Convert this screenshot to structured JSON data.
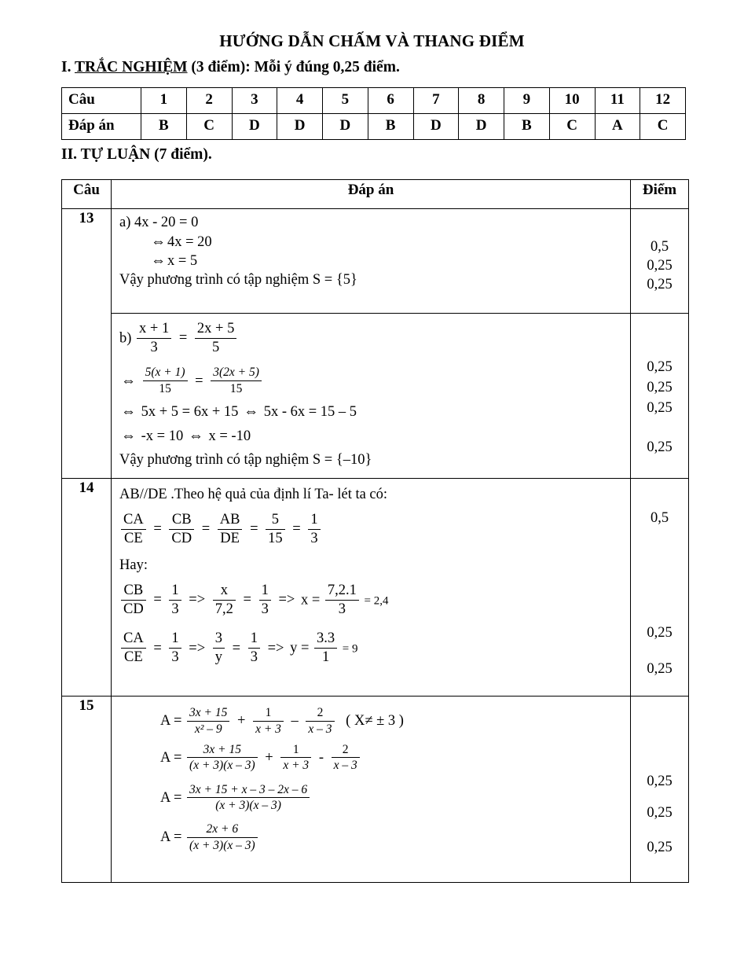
{
  "document": {
    "title": "HƯỚNG DẪN CHẤM VÀ THANG ĐIỂM"
  },
  "section_mcq": {
    "heading_prefix": "I. ",
    "heading_underlined": "TRẮC NGHIỆM",
    "heading_rest": " (3 điểm): Mỗi ý đúng 0,25 điểm.",
    "table": {
      "row_label_question": "Câu",
      "row_label_answer": "Đáp án",
      "questions": [
        "1",
        "2",
        "3",
        "4",
        "5",
        "6",
        "7",
        "8",
        "9",
        "10",
        "11",
        "12"
      ],
      "answers": [
        "B",
        "C",
        "D",
        "D",
        "D",
        "B",
        "D",
        "D",
        "B",
        "C",
        "A",
        "C"
      ]
    }
  },
  "section_essay": {
    "heading_prefix": "II. ",
    "heading_underlined": "TỰ LUẬN",
    "heading_rest": " (7 điểm).",
    "headers": {
      "cau": "Câu",
      "dap_an": "Đáp án",
      "diem": "Điểm"
    },
    "q13": {
      "number": "13",
      "part_a": {
        "l1": "a) 4x - 20 = 0",
        "l2_eqv": "⇔",
        "l2": "4x = 20",
        "l3_eqv": "⇔",
        "l3": "x = 5",
        "l4": "Vậy phương trình có tập nghiệm  S = {5}",
        "points": [
          "0,5",
          "0,25",
          "0,25"
        ]
      },
      "part_b": {
        "label": "b)",
        "eq1": {
          "n1": "x + 1",
          "d1": "3",
          "n2": "2x + 5",
          "d2": "5"
        },
        "eq2": {
          "n1": "5(x + 1)",
          "d1": "15",
          "n2": "3(2x + 5)",
          "d2": "15"
        },
        "eq3": "5x + 5 = 6x + 15",
        "eq3b": "5x - 6x = 15 – 5",
        "eq4": "-x  = 10",
        "eq4b": "x = -10",
        "eq5": "Vậy phương trình có tập nghiệm  S = {–10}",
        "points": [
          "0,25",
          "0,25",
          "0,25",
          "0,25"
        ]
      }
    },
    "q14": {
      "number": "14",
      "l1": "AB//DE .Theo hệ quả của định lí Ta- lét ta có:",
      "chain1": [
        {
          "num": "CA",
          "den": "CE"
        },
        {
          "num": "CB",
          "den": "CD"
        },
        {
          "num": "AB",
          "den": "DE"
        },
        {
          "num": "5",
          "den": "15"
        },
        {
          "num": "1",
          "den": "3"
        }
      ],
      "hay": "Hay:",
      "chain2": {
        "f1": {
          "num": "CB",
          "den": "CD"
        },
        "f2": {
          "num": "1",
          "den": "3"
        },
        "arrow": "=>",
        "f3": {
          "num": "x",
          "den": "7,2"
        },
        "f4": {
          "num": "1",
          "den": "3"
        },
        "arrow2": "=>",
        "var": "x =",
        "f5": {
          "num": "7,2.1",
          "den": "3"
        },
        "result": "= 2,4"
      },
      "chain3": {
        "f1": {
          "num": "CA",
          "den": "CE"
        },
        "f2": {
          "num": "1",
          "den": "3"
        },
        "arrow": "=>",
        "f3": {
          "num": "3",
          "den": "y"
        },
        "f4": {
          "num": "1",
          "den": "3"
        },
        "arrow2": "=>",
        "var": "y =",
        "f5": {
          "num": "3.3",
          "den": "1"
        },
        "result": "= 9"
      },
      "points": [
        "0,5",
        "0,25",
        "0,25"
      ]
    },
    "q15": {
      "number": "15",
      "line1": {
        "lead": "A =",
        "f1": {
          "num": "3x + 15",
          "den": "x² – 9"
        },
        "op1": "+",
        "f2": {
          "num": "1",
          "den": "x + 3"
        },
        "op2": "–",
        "f3": {
          "num": "2",
          "den": "x – 3"
        },
        "cond": "( X≠ ± 3 )"
      },
      "line2": {
        "lead": "A =",
        "f1": {
          "num": "3x + 15",
          "den": "(x + 3)(x – 3)"
        },
        "op1": "+",
        "f2": {
          "num": "1",
          "den": "x + 3"
        },
        "op2": "-",
        "f3": {
          "num": "2",
          "den": "x – 3"
        }
      },
      "line3": {
        "lead": "A  =",
        "f1": {
          "num": "3x + 15 + x – 3 – 2x – 6",
          "den": "(x + 3)(x – 3)"
        }
      },
      "line4": {
        "lead": "A =",
        "f1": {
          "num": "2x + 6",
          "den": "(x + 3)(x – 3)"
        }
      },
      "points": [
        "0,25",
        "0,25",
        "0,25"
      ]
    }
  }
}
